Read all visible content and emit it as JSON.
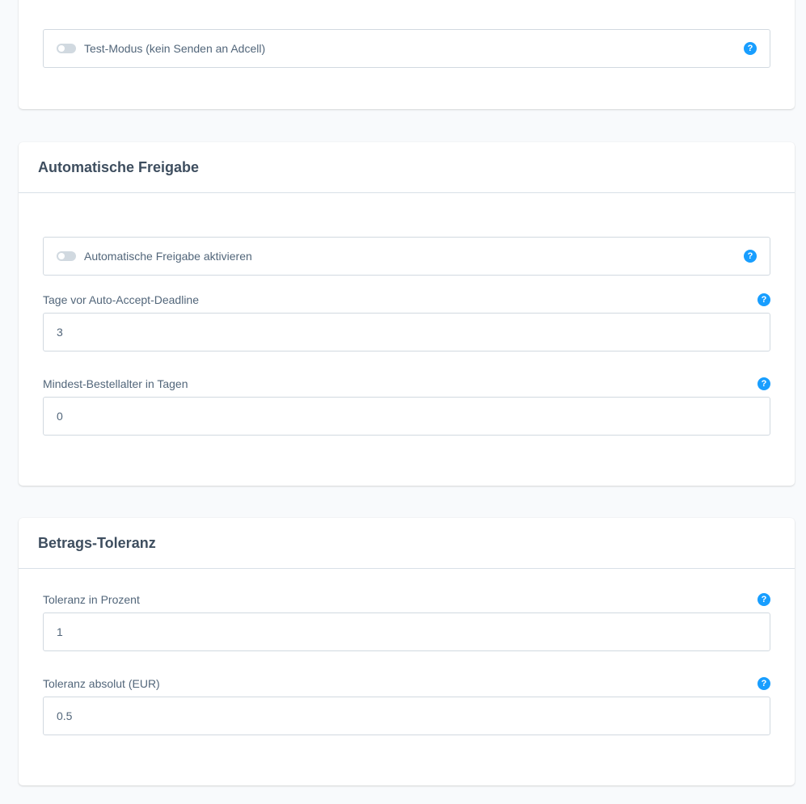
{
  "sections": {
    "test_mode": {
      "toggle_label": "Test-Modus (kein Senden an Adcell)"
    },
    "auto_release": {
      "title": "Automatische Freigabe",
      "toggle_label": "Automatische Freigabe aktivieren",
      "fields": [
        {
          "label": "Tage vor Auto-Accept-Deadline",
          "value": "3"
        },
        {
          "label": "Mindest-Bestellalter in Tagen",
          "value": "0"
        }
      ]
    },
    "amount_tolerance": {
      "title": "Betrags-Toleranz",
      "fields": [
        {
          "label": "Toleranz in Prozent",
          "value": "1"
        },
        {
          "label": "Toleranz absolut (EUR)",
          "value": "0.5"
        }
      ]
    }
  },
  "help_glyph": "?",
  "colors": {
    "accent": "#189eff",
    "background": "#f8fafc",
    "border": "#d1d9e0",
    "text": "#52667a",
    "title": "#3e4e5f"
  },
  "icons": {
    "help": "help-question-icon",
    "toggle": "toggle-switch-off"
  }
}
